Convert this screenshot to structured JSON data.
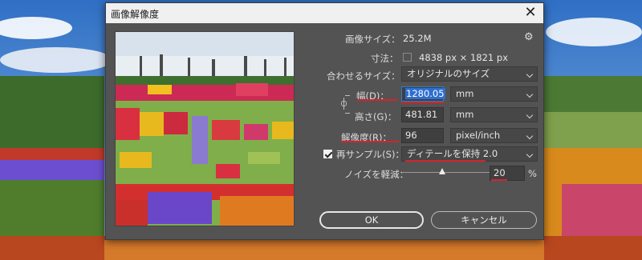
{
  "dialog": {
    "title": "画像解像度",
    "image_size_label": "画像サイズ：",
    "image_size_value": "25.2M",
    "dimensions_label": "寸法：",
    "dimensions_value": "4838 px × 1821 px",
    "fit_label": "合わせるサイズ：",
    "fit_value": "オリジナルのサイズ",
    "width_label": "幅(D)：",
    "width_value": "1280.05",
    "width_unit": "mm",
    "height_label": "高さ(G)：",
    "height_value": "481.81",
    "height_unit": "mm",
    "resolution_label": "解像度(R)：",
    "resolution_value": "96",
    "resolution_unit": "pixel/inch",
    "resample_label": "再サンプル(S)：",
    "resample_checked": true,
    "resample_value": "ディテールを保持 2.0",
    "noise_label": "ノイズを軽減：",
    "noise_value": "20",
    "noise_unit": "%",
    "ok_label": "OK",
    "cancel_label": "キャンセル"
  },
  "icons": {
    "close": "close-icon",
    "gear": "gear-icon",
    "link": "link-icon",
    "dropdown": "chevron-down-icon"
  },
  "colors": {
    "dialog_bg": "#535353",
    "field_bg": "#474747",
    "focus": "#2d7bd5",
    "underline": "#d4242b"
  }
}
